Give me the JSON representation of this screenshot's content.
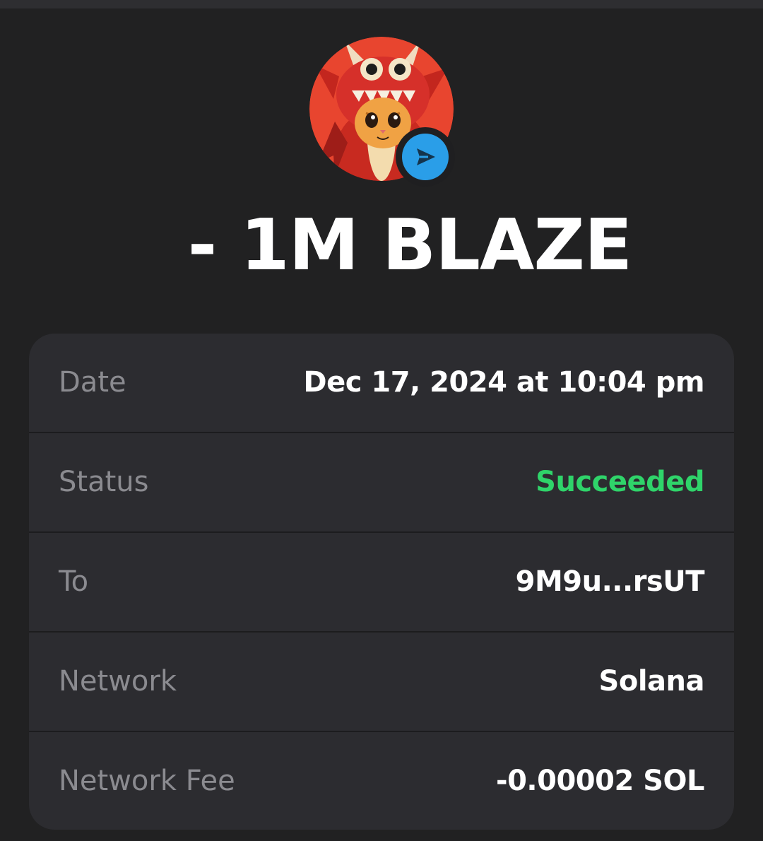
{
  "transaction": {
    "amount_text": "- 1M BLAZE",
    "token_logo_icon": "dragon-costume-cat-logo",
    "direction_icon": "send-arrow-icon",
    "colors": {
      "success": "#2fd46a",
      "send_badge": "#2a9ee8",
      "logo_background": "#e8452f"
    }
  },
  "details": {
    "date": {
      "label": "Date",
      "value": "Dec 17, 2024 at 10:04 pm"
    },
    "status": {
      "label": "Status",
      "value": "Succeeded"
    },
    "to": {
      "label": "To",
      "value": "9M9u...rsUT"
    },
    "network": {
      "label": "Network",
      "value": "Solana"
    },
    "network_fee": {
      "label": "Network Fee",
      "value": "-0.00002 SOL"
    }
  }
}
